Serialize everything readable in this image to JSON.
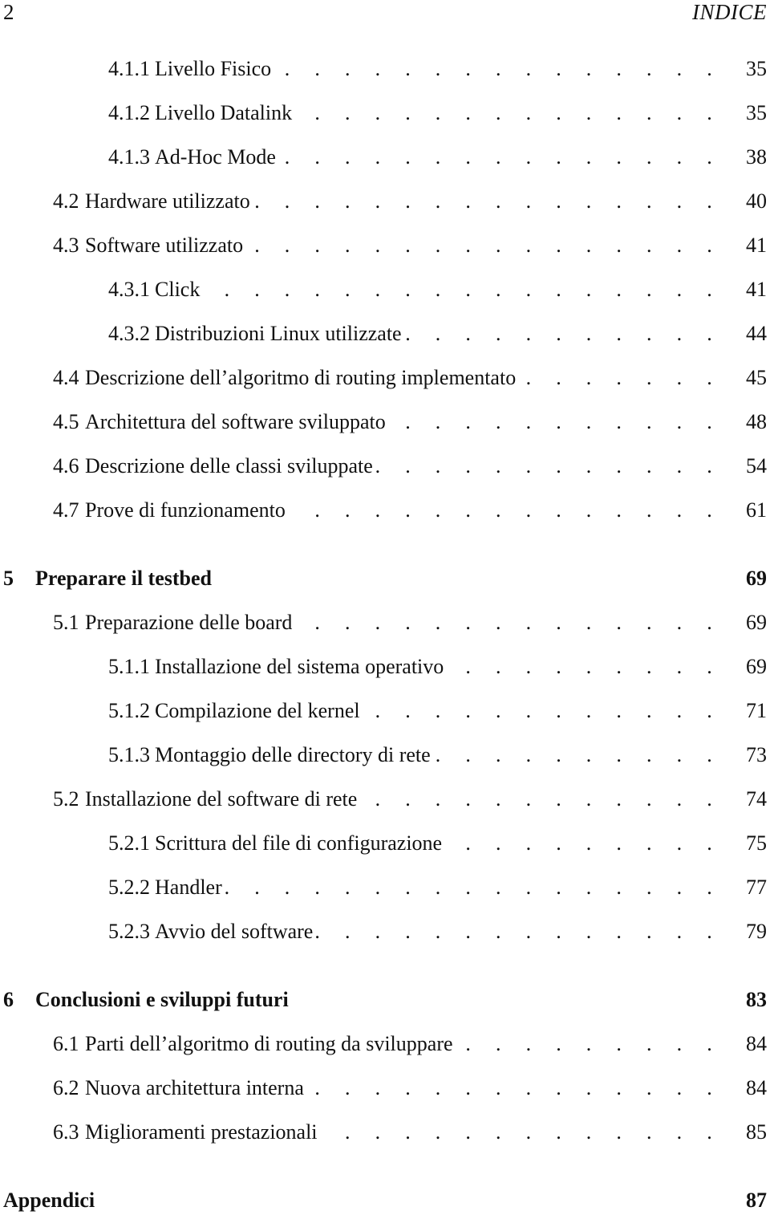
{
  "header": {
    "page_number": "2",
    "running_title": "INDICE"
  },
  "toc": {
    "leader_dots": ". . . . . . . . . . . . . . . . . . . . . . . . . . . . . . . . . . . . . . . . . . . . . . . .",
    "entries": [
      {
        "level": "sub",
        "number": "4.1.1",
        "title": "Livello Fisico",
        "page": "35"
      },
      {
        "level": "sub",
        "number": "4.1.2",
        "title": "Livello Datalink",
        "page": "35"
      },
      {
        "level": "sub",
        "number": "4.1.3",
        "title": "Ad-Hoc Mode",
        "page": "38"
      },
      {
        "level": "sec",
        "number": "4.2",
        "title": "Hardware utilizzato",
        "page": "40"
      },
      {
        "level": "sec",
        "number": "4.3",
        "title": "Software utilizzato",
        "page": "41"
      },
      {
        "level": "sub",
        "number": "4.3.1",
        "title": "Click",
        "page": "41"
      },
      {
        "level": "sub",
        "number": "4.3.2",
        "title": "Distribuzioni Linux utilizzate",
        "page": "44"
      },
      {
        "level": "sec",
        "number": "4.4",
        "title": "Descrizione dell’algoritmo di routing implementato",
        "page": "45"
      },
      {
        "level": "sec",
        "number": "4.5",
        "title": "Architettura del software sviluppato",
        "page": "48"
      },
      {
        "level": "sec",
        "number": "4.6",
        "title": "Descrizione delle classi sviluppate",
        "page": "54"
      },
      {
        "level": "sec",
        "number": "4.7",
        "title": "Prove di funzionamento",
        "page": "61"
      },
      {
        "level": "ch",
        "number": "5",
        "title": "Preparare il testbed",
        "page": "69"
      },
      {
        "level": "sec",
        "number": "5.1",
        "title": "Preparazione delle board",
        "page": "69"
      },
      {
        "level": "sub",
        "number": "5.1.1",
        "title": "Installazione del sistema operativo",
        "page": "69"
      },
      {
        "level": "sub",
        "number": "5.1.2",
        "title": "Compilazione del kernel",
        "page": "71"
      },
      {
        "level": "sub",
        "number": "5.1.3",
        "title": "Montaggio delle directory di rete",
        "page": "73"
      },
      {
        "level": "sec",
        "number": "5.2",
        "title": "Installazione del software di rete",
        "page": "74"
      },
      {
        "level": "sub",
        "number": "5.2.1",
        "title": "Scrittura del file di configurazione",
        "page": "75"
      },
      {
        "level": "sub",
        "number": "5.2.2",
        "title": "Handler",
        "page": "77"
      },
      {
        "level": "sub",
        "number": "5.2.3",
        "title": "Avvio del software",
        "page": "79"
      },
      {
        "level": "ch",
        "number": "6",
        "title": "Conclusioni e sviluppi futuri",
        "page": "83"
      },
      {
        "level": "sec",
        "number": "6.1",
        "title": "Parti dell’algoritmo di routing da sviluppare",
        "page": "84"
      },
      {
        "level": "sec",
        "number": "6.2",
        "title": "Nuova architettura interna",
        "page": "84"
      },
      {
        "level": "sec",
        "number": "6.3",
        "title": "Miglioramenti prestazionali",
        "page": "85"
      },
      {
        "level": "app",
        "number": "",
        "title": "Appendici",
        "page": "87"
      }
    ]
  }
}
